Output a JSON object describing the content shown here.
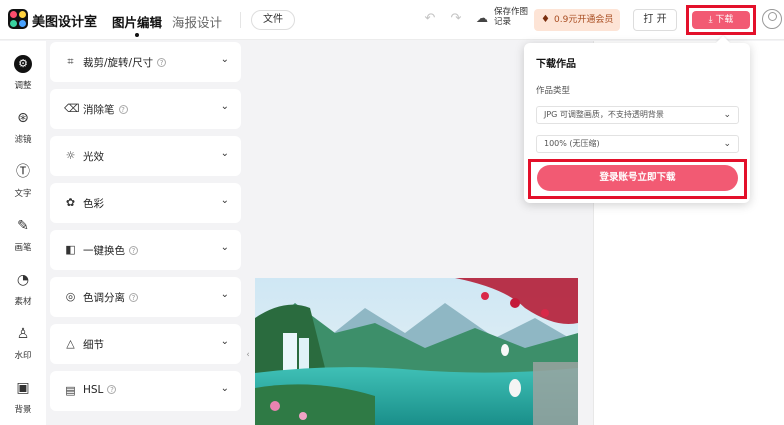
{
  "header": {
    "app_name": "美图设计室",
    "tabs": [
      {
        "label": "图片编辑",
        "active": true
      },
      {
        "label": "海报设计",
        "active": false
      }
    ],
    "file_label": "文件",
    "save_label": "保存作图记录",
    "vip_label": "0.9元开通会员",
    "open_label": "打 开",
    "download_label": "下载"
  },
  "sidebar": {
    "items": [
      {
        "label": "调整",
        "icon": "sliders-icon",
        "active": true
      },
      {
        "label": "滤镜",
        "icon": "filter-icon"
      },
      {
        "label": "文字",
        "icon": "text-icon"
      },
      {
        "label": "画笔",
        "icon": "brush-icon"
      },
      {
        "label": "素材",
        "icon": "sticker-icon"
      },
      {
        "label": "水印",
        "icon": "watermark-icon"
      },
      {
        "label": "背景",
        "icon": "background-icon"
      }
    ]
  },
  "adjust_panel": {
    "sections": [
      {
        "label": "裁剪/旋转/尺寸",
        "icon": "crop-icon",
        "help": true
      },
      {
        "label": "消除笔",
        "icon": "eraser-icon",
        "help": true
      },
      {
        "label": "光效",
        "icon": "sun-icon",
        "help": false
      },
      {
        "label": "色彩",
        "icon": "palette-icon",
        "help": false
      },
      {
        "label": "一键换色",
        "icon": "recolor-icon",
        "help": true
      },
      {
        "label": "色调分离",
        "icon": "split-tone-icon",
        "help": true
      },
      {
        "label": "细节",
        "icon": "detail-icon",
        "help": false
      },
      {
        "label": "HSL",
        "icon": "hsl-icon",
        "help": true
      }
    ]
  },
  "download_popover": {
    "title": "下载作品",
    "format_label": "作品类型",
    "format_value": "JPG 可调整画质，不支持透明背景",
    "quality_value": "100% (无压缩)",
    "login_button": "登录账号立即下载"
  },
  "colors": {
    "accent": "#f25a73",
    "highlight_frame": "#e3102a",
    "vip_bg": "#fde4d6"
  }
}
